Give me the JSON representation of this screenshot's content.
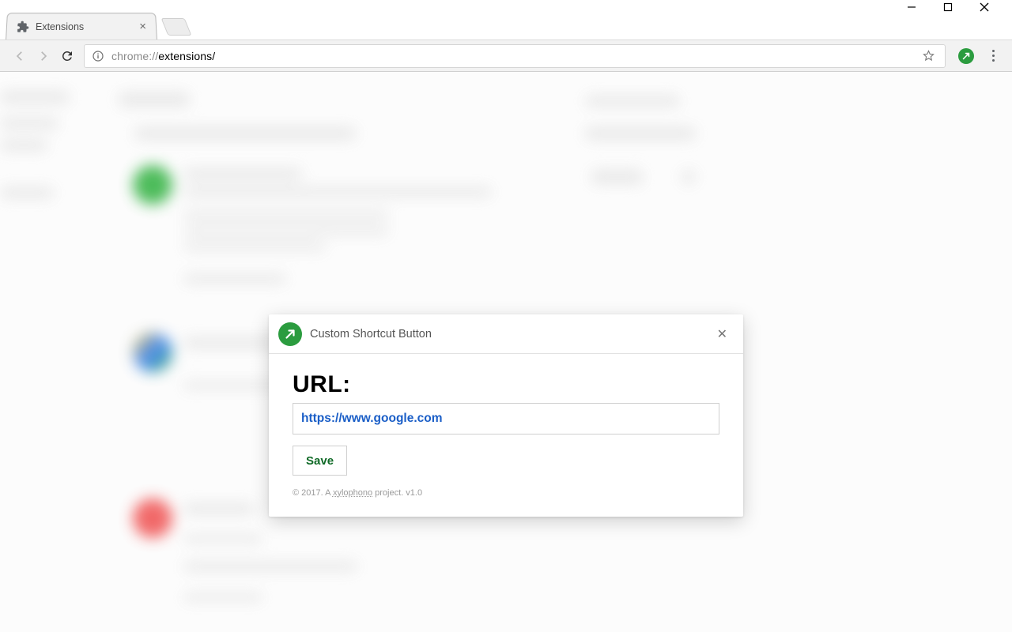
{
  "window": {
    "minimize": "",
    "maximize": "",
    "close": ""
  },
  "tab": {
    "title": "Extensions"
  },
  "toolbar": {
    "url_scheme_host": "chrome://",
    "url_path": "extensions/"
  },
  "modal": {
    "title": "Custom Shortcut Button",
    "url_label": "URL:",
    "url_value": "https://www.google.com",
    "save_label": "Save",
    "footer_prefix": "© 2017. A ",
    "footer_link": "xylophono",
    "footer_suffix": " project. v1.0"
  }
}
